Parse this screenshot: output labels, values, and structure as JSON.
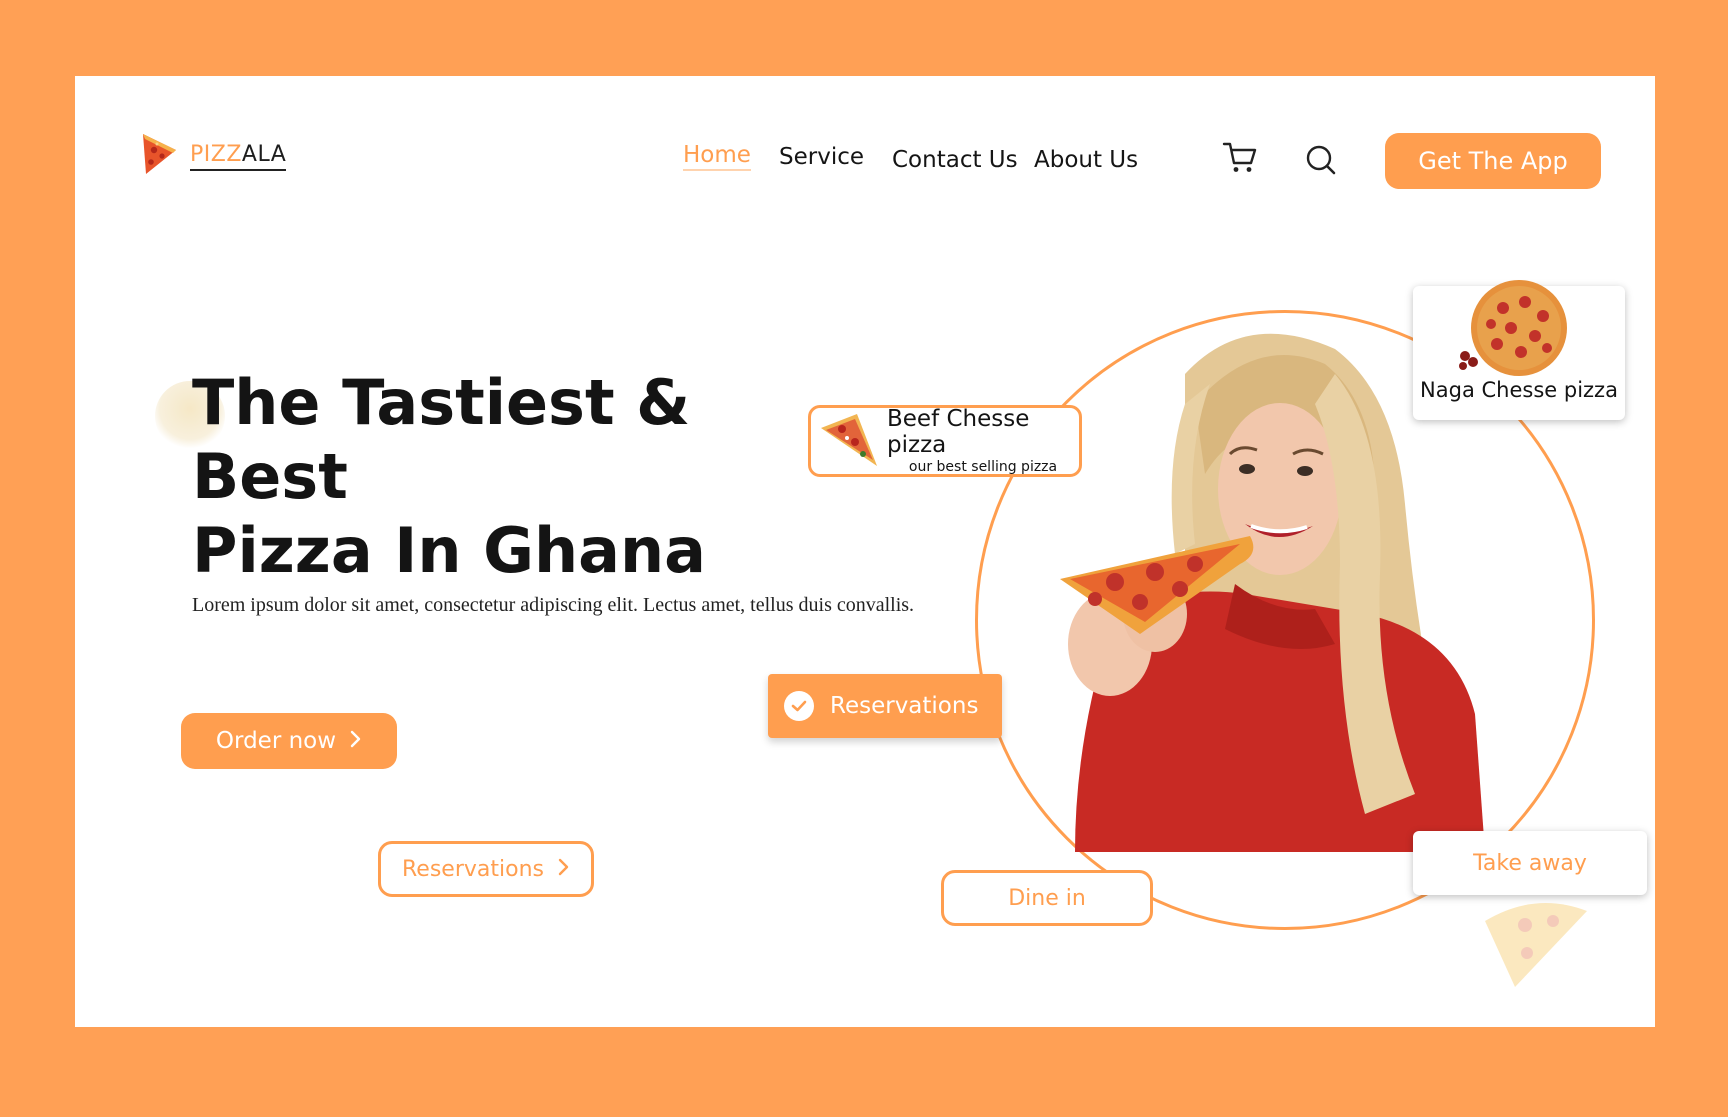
{
  "brand": {
    "name_part1": "PIZZ",
    "name_part2": "ALA"
  },
  "nav": {
    "home": "Home",
    "service": "Service",
    "contact": "Contact Us",
    "about": "About Us"
  },
  "header": {
    "cta_label": "Get The App"
  },
  "hero": {
    "headline_line1": "The Tastiest & Best",
    "headline_line2": "Pizza In Ghana",
    "description": "Lorem ipsum dolor sit amet, consectetur adipiscing elit. Lectus amet, tellus duis convallis.",
    "order_label": "Order now",
    "reservations_label": "Reservations"
  },
  "floating": {
    "reservations_badge": "Reservations",
    "beef_title": "Beef Chesse pizza",
    "beef_subtitle": "our best selling pizza",
    "naga_title": "Naga Chesse pizza",
    "take_away": "Take away",
    "dine_in": "Dine in"
  },
  "colors": {
    "accent": "#FF9E4F",
    "page_bg": "#FFA055",
    "card_bg": "#FFFFFF",
    "text": "#141414"
  },
  "icons": [
    "pizza-slice-icon",
    "cart-icon",
    "search-icon",
    "chevron-right-icon",
    "check-icon"
  ]
}
